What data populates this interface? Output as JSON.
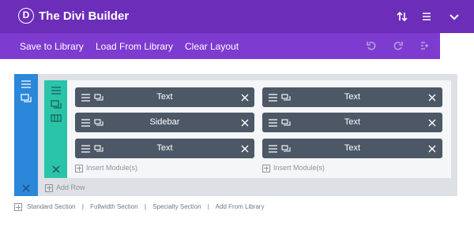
{
  "header": {
    "logo_letter": "D",
    "title": "The Divi Builder",
    "icons": [
      "sort-arrows-icon",
      "hamburger-icon",
      "chevron-down-icon"
    ]
  },
  "toolbar": {
    "save_label": "Save to Library",
    "load_label": "Load From Library",
    "clear_label": "Clear Layout",
    "icons": [
      "undo-icon",
      "redo-icon",
      "history-icon"
    ]
  },
  "columns": [
    {
      "modules": [
        "Text",
        "Sidebar",
        "Text"
      ],
      "insert_label": "Insert Module(s)"
    },
    {
      "modules": [
        "Text",
        "Text",
        "Text"
      ],
      "insert_label": "Insert Module(s)"
    }
  ],
  "add_row_label": "Add Row",
  "footer": {
    "standard": "Standard Section",
    "fullwidth": "Fullwidth Section",
    "specialty": "Specialty Section",
    "add_library": "Add From Library",
    "separator": "|"
  },
  "colors": {
    "header_bg": "#6c2eb9",
    "toolbar_bg": "#7e3bd0",
    "section_blue": "#2b87da",
    "row_teal": "#29c4a9",
    "module_bg": "#4c5866"
  }
}
